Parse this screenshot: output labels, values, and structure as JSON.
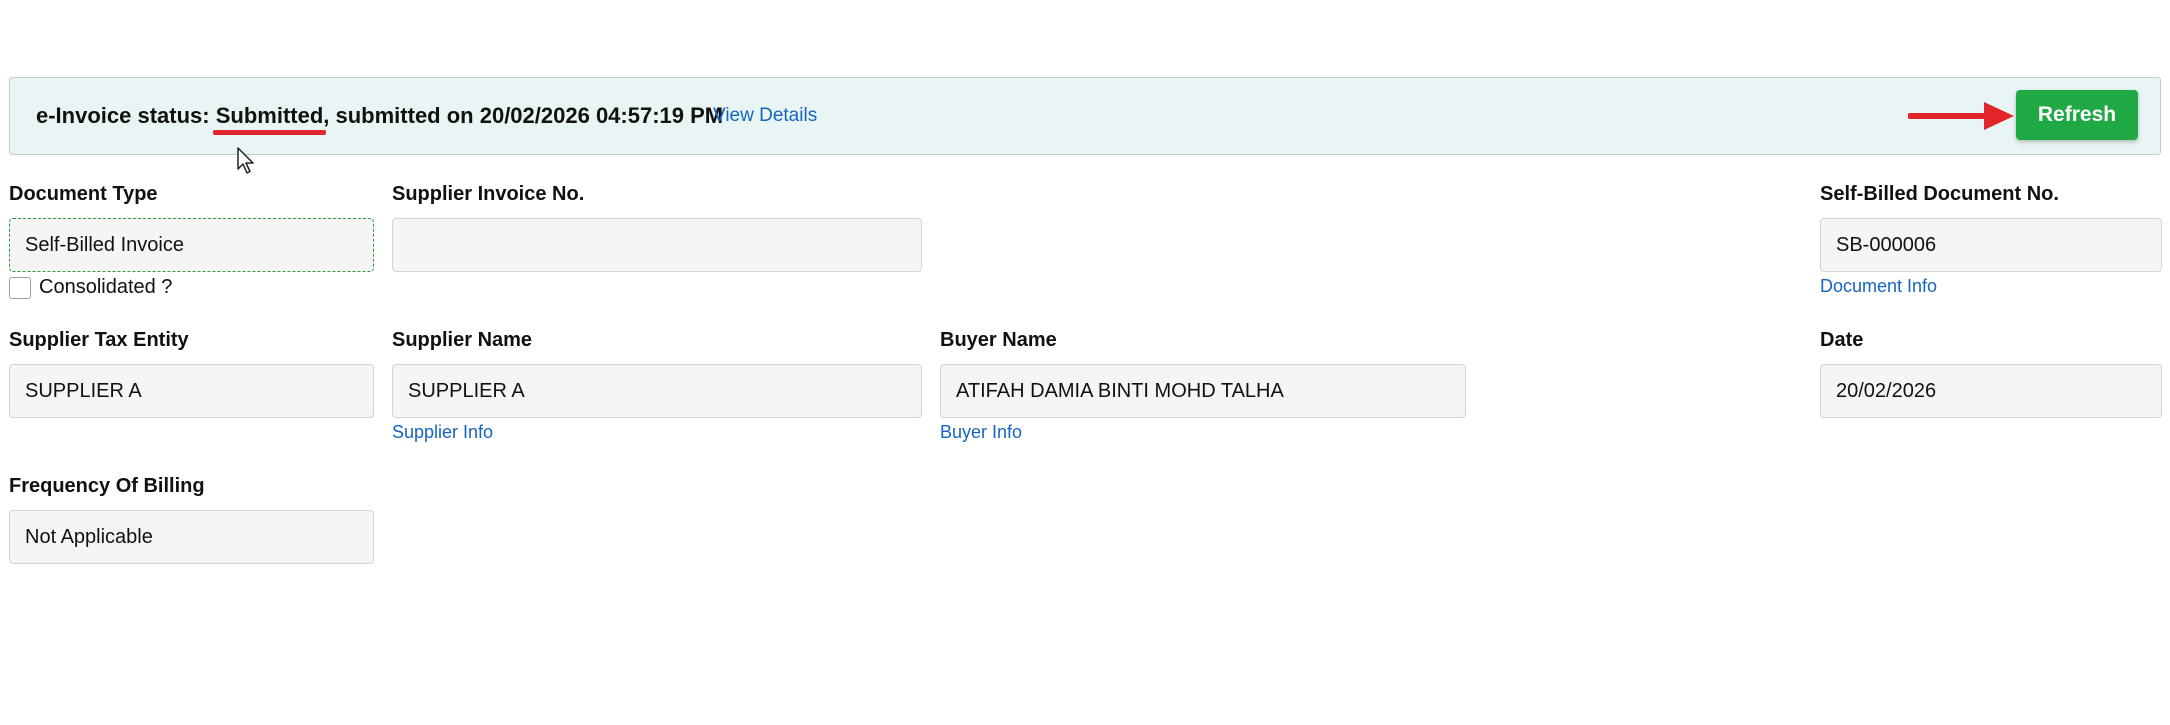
{
  "status_bar": {
    "prefix": "e-Invoice status: ",
    "status": "Submitted",
    "suffix": ", submitted on 20/02/2026 04:57:19 PM",
    "view_details": "View Details",
    "refresh_label": "Refresh",
    "accent_color": "#1fa945",
    "annotation_color": "#e2242b"
  },
  "form": {
    "document_type": {
      "label": "Document Type",
      "value": "Self-Billed Invoice"
    },
    "consolidated": {
      "label": "Consolidated ?",
      "checked": false
    },
    "supplier_invoice_no": {
      "label": "Supplier Invoice No.",
      "value": ""
    },
    "self_billed_document_no": {
      "label": "Self-Billed Document No.",
      "value": "SB-000006",
      "link": "Document Info"
    },
    "supplier_tax_entity": {
      "label": "Supplier Tax Entity",
      "value": "SUPPLIER A"
    },
    "supplier_name": {
      "label": "Supplier Name",
      "value": "SUPPLIER A",
      "link": "Supplier Info"
    },
    "buyer_name": {
      "label": "Buyer Name",
      "value": "ATIFAH DAMIA BINTI MOHD TALHA",
      "link": "Buyer Info"
    },
    "date": {
      "label": "Date",
      "value": "20/02/2026"
    },
    "frequency_of_billing": {
      "label": "Frequency Of Billing",
      "value": "Not Applicable"
    }
  },
  "link_color": "#1565c0"
}
